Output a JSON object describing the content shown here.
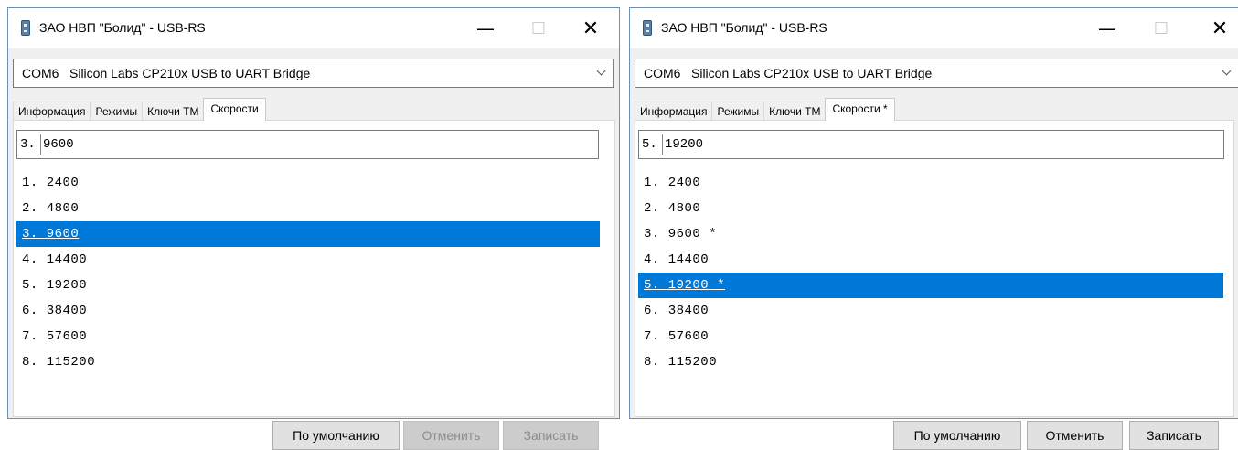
{
  "windows": [
    {
      "title": "ЗАО НВП \"Болид\" - USB-RS",
      "port": {
        "com": "COM6",
        "description": "Silicon Labs CP210x USB to UART Bridge"
      },
      "tabs": [
        {
          "label": "Информация",
          "active": false
        },
        {
          "label": "Режимы",
          "active": false
        },
        {
          "label": "Ключи ТМ",
          "active": false
        },
        {
          "label": "Скорости",
          "active": true
        }
      ],
      "edit": {
        "prefix": "3.",
        "value": "9600"
      },
      "speeds": [
        {
          "label": "1. 2400",
          "selected": false
        },
        {
          "label": "2. 4800",
          "selected": false
        },
        {
          "label": "3. 9600",
          "selected": true
        },
        {
          "label": "4. 14400",
          "selected": false
        },
        {
          "label": "5. 19200",
          "selected": false
        },
        {
          "label": "6. 38400",
          "selected": false
        },
        {
          "label": "7. 57600",
          "selected": false
        },
        {
          "label": "8. 115200",
          "selected": false
        }
      ],
      "buttons": {
        "default": {
          "label": "По умолчанию",
          "enabled": true
        },
        "cancel": {
          "label": "Отменить",
          "enabled": false
        },
        "write": {
          "label": "Записать",
          "enabled": false
        }
      }
    },
    {
      "title": "ЗАО НВП \"Болид\" - USB-RS",
      "port": {
        "com": "COM6",
        "description": "Silicon Labs CP210x USB to UART Bridge"
      },
      "tabs": [
        {
          "label": "Информация",
          "active": false
        },
        {
          "label": "Режимы",
          "active": false
        },
        {
          "label": "Ключи ТМ",
          "active": false
        },
        {
          "label": "Скорости *",
          "active": true
        }
      ],
      "edit": {
        "prefix": "5.",
        "value": "19200"
      },
      "speeds": [
        {
          "label": "1. 2400",
          "selected": false
        },
        {
          "label": "2. 4800",
          "selected": false
        },
        {
          "label": "3. 9600 *",
          "selected": false
        },
        {
          "label": "4. 14400",
          "selected": false
        },
        {
          "label": "5. 19200 *",
          "selected": true
        },
        {
          "label": "6. 38400",
          "selected": false
        },
        {
          "label": "7. 57600",
          "selected": false
        },
        {
          "label": "8. 115200",
          "selected": false
        }
      ],
      "buttons": {
        "default": {
          "label": "По умолчанию",
          "enabled": true
        },
        "cancel": {
          "label": "Отменить",
          "enabled": true
        },
        "write": {
          "label": "Записать",
          "enabled": true
        }
      }
    }
  ],
  "icons": {
    "app": "usb-device-icon",
    "minimize": "minimize-icon",
    "maximize": "maximize-icon",
    "close": "close-icon",
    "dropdown": "chevron-down-icon"
  },
  "colors": {
    "selection": "#0078d7",
    "window_border": "#6d8fb3",
    "client_bg": "#f0f0f0"
  }
}
